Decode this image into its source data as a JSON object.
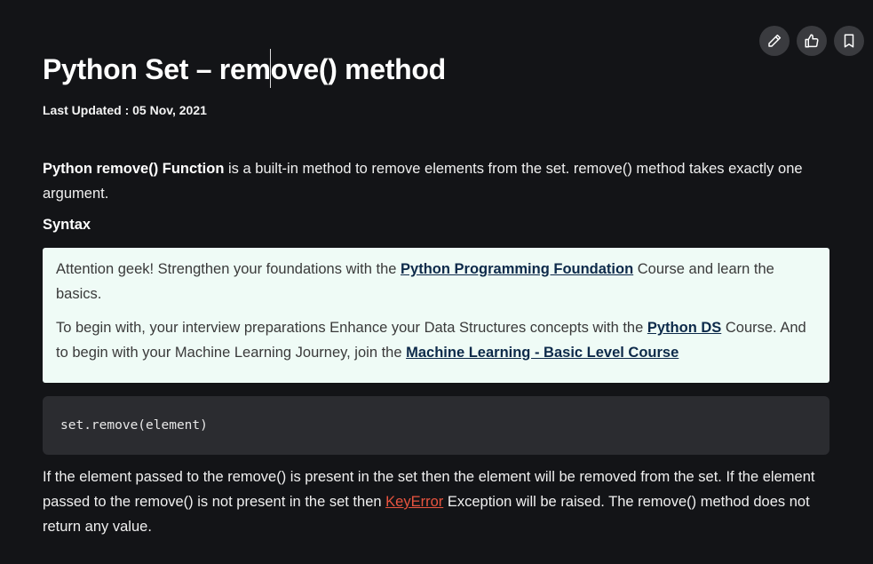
{
  "article": {
    "title_part1": "Python Set – rem",
    "title_part2": "ove() method",
    "last_updated": "Last Updated : 05 Nov, 2021",
    "intro_bold": "Python remove() Function",
    "intro_text": " is a built-in method to remove elements from the set. remove() method takes exactly one argument.",
    "syntax_heading": "Syntax",
    "code": "set.remove(element)",
    "desc_part1": "If the element passed to the remove() is present in the set then the element will be removed from the set. If the element passed to the remove() is not present in the set then ",
    "desc_link": "KeyError",
    "desc_part2": " Exception will be raised. The remove() method does not return any value."
  },
  "notice": {
    "line1_pre": " Attention geek! Strengthen your foundations with the ",
    "line1_link": "Python Programming Foundation",
    "line1_post": " Course and learn the basics.",
    "line2_pre": "To begin with, your interview preparations Enhance your Data Structures concepts with the ",
    "line2_link1": "Python DS",
    "line2_mid": " Course. And to begin with your Machine Learning Journey, join the ",
    "line2_link2": "Machine Learning - Basic Level Course"
  },
  "actions": {
    "icons": [
      "edit-icon",
      "thumbs-up-icon",
      "bookmark-icon"
    ]
  },
  "colors": {
    "background": "#131417",
    "notice_bg": "#effbf6",
    "code_bg": "#2b2c30",
    "link_red": "#e8543f"
  }
}
